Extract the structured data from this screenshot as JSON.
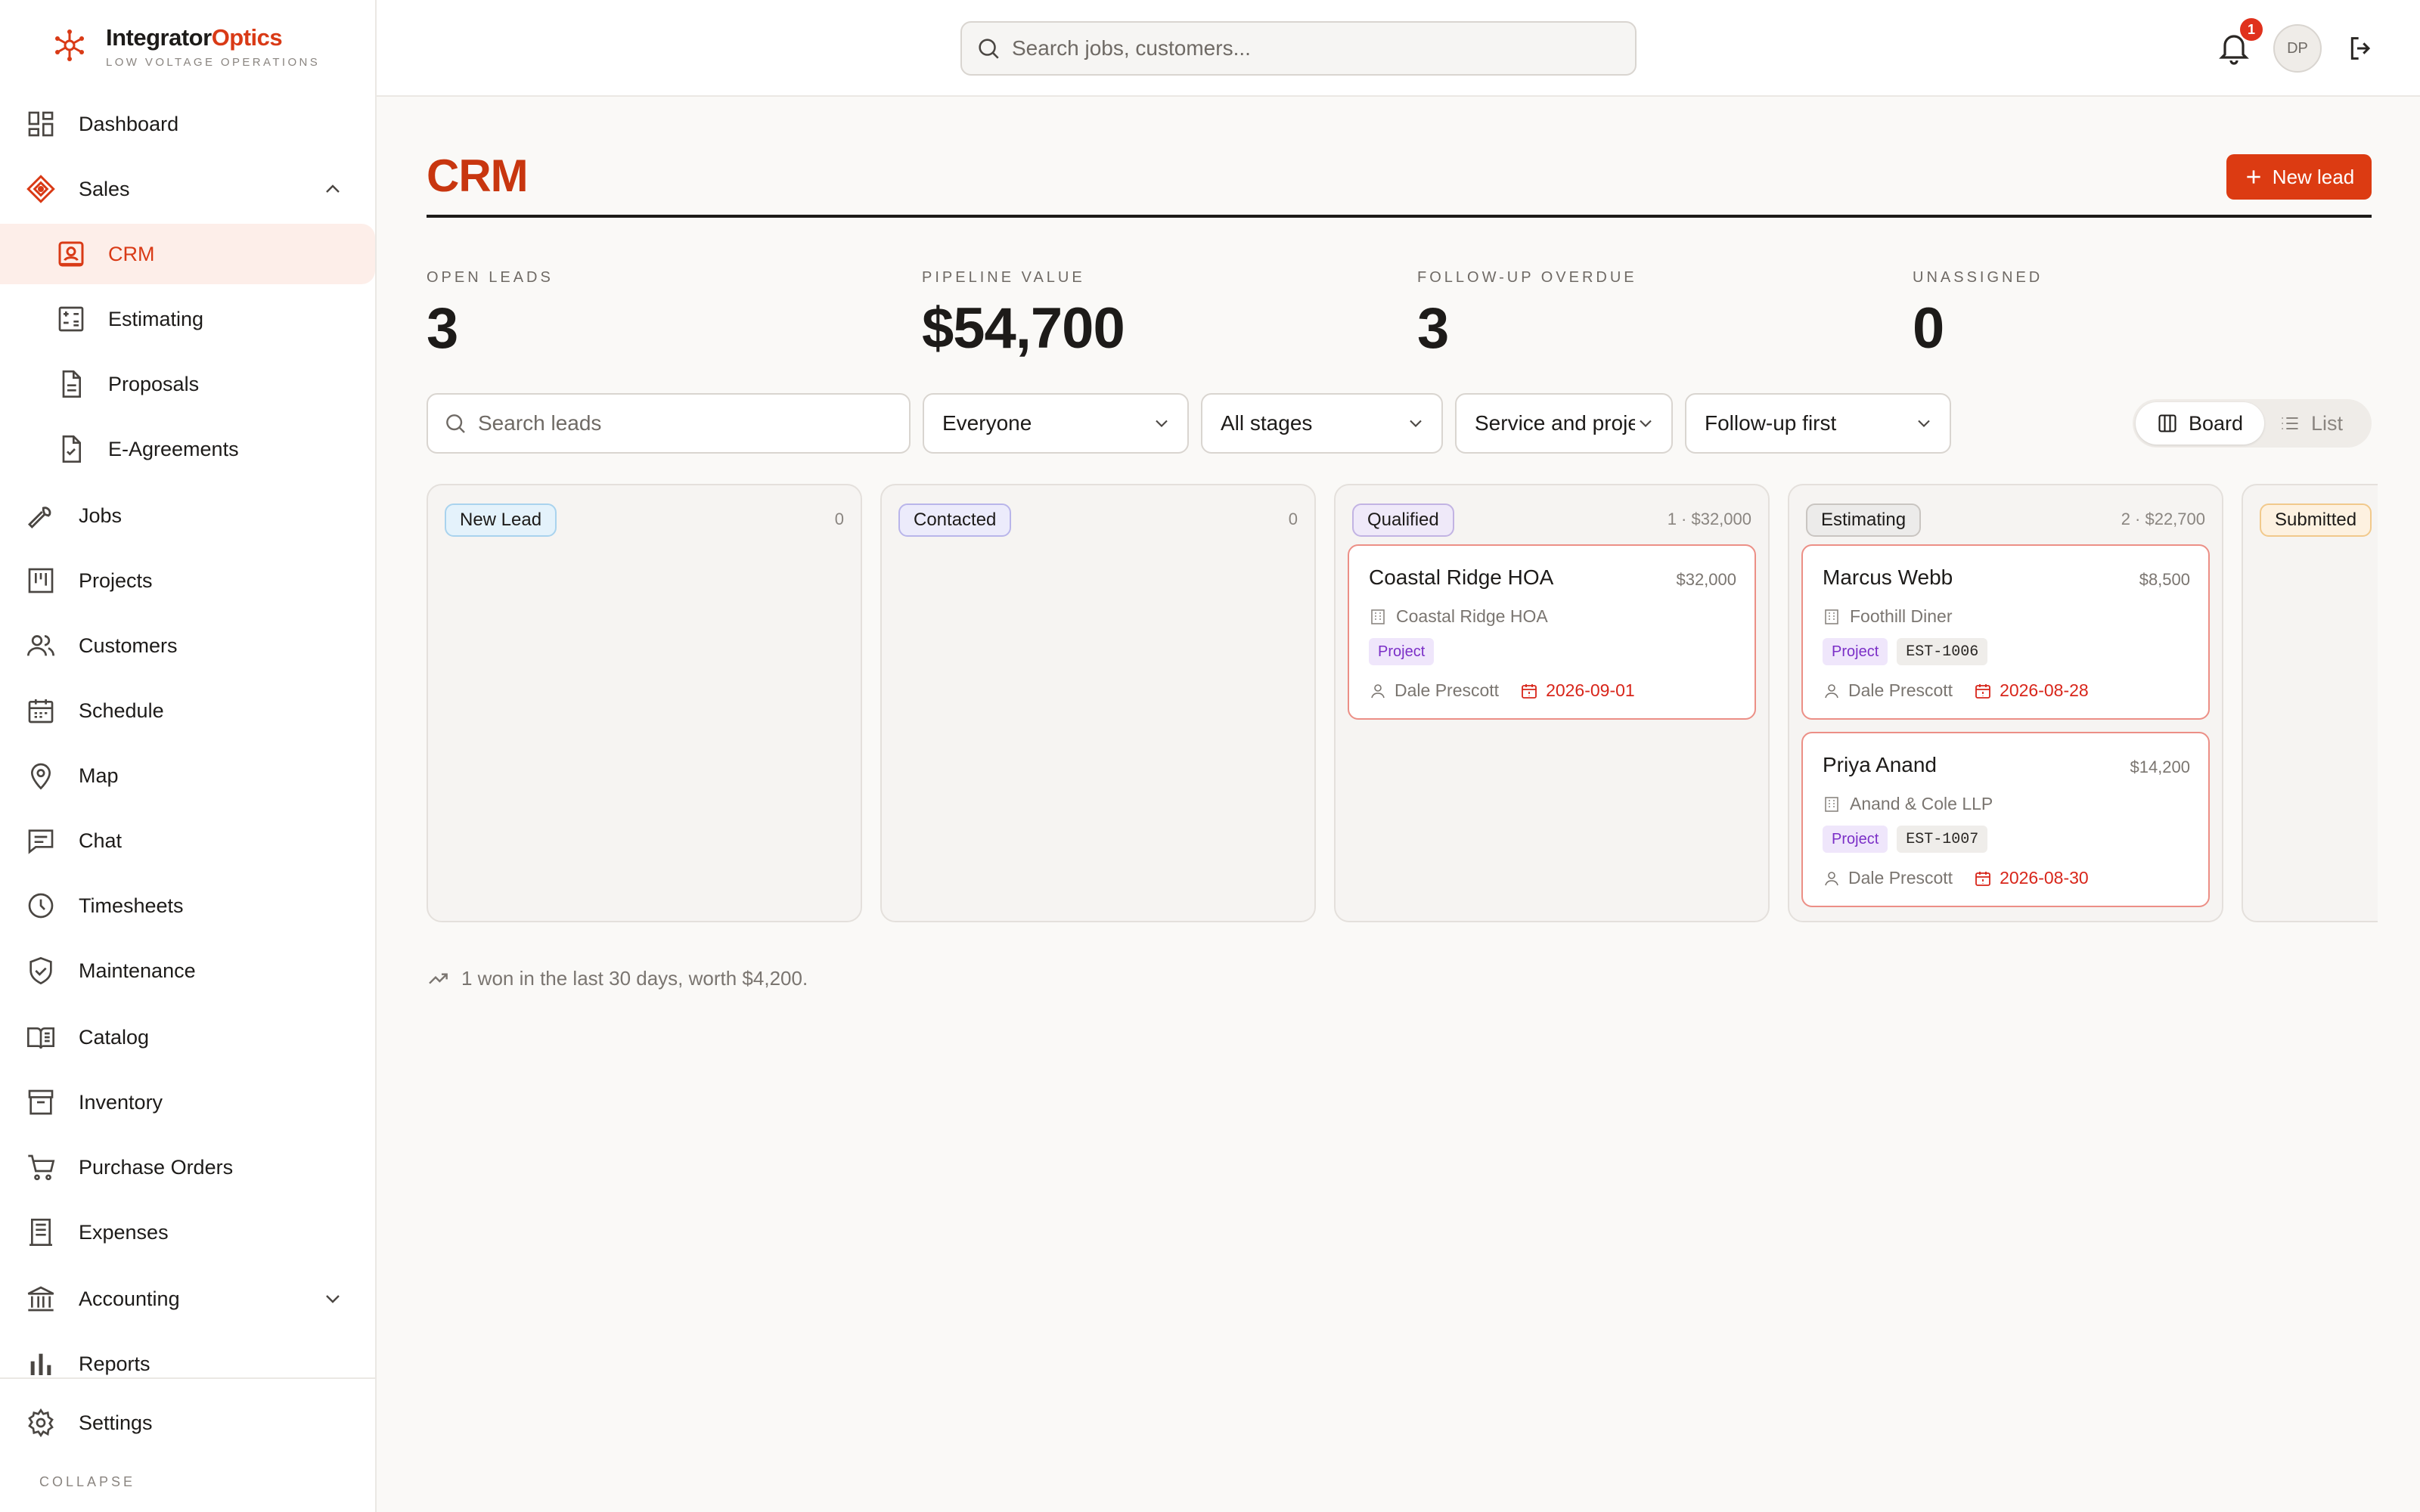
{
  "brand": {
    "name_part1": "Integrator",
    "name_part2": "Optics",
    "tagline": "LOW VOLTAGE OPERATIONS"
  },
  "sidebar": {
    "items": [
      {
        "label": "Dashboard",
        "icon": "dashboard-icon"
      },
      {
        "label": "Sales",
        "icon": "tag-icon",
        "expanded": true
      },
      {
        "label": "CRM",
        "icon": "contact-card-icon",
        "active": true
      },
      {
        "label": "Estimating",
        "icon": "calculator-icon"
      },
      {
        "label": "Proposals",
        "icon": "document-icon"
      },
      {
        "label": "E-Agreements",
        "icon": "document-check-icon"
      },
      {
        "label": "Jobs",
        "icon": "wrench-icon"
      },
      {
        "label": "Projects",
        "icon": "kanban-icon"
      },
      {
        "label": "Customers",
        "icon": "users-icon"
      },
      {
        "label": "Schedule",
        "icon": "calendar-icon"
      },
      {
        "label": "Map",
        "icon": "map-pin-icon"
      },
      {
        "label": "Chat",
        "icon": "chat-icon"
      },
      {
        "label": "Timesheets",
        "icon": "clock-icon"
      },
      {
        "label": "Maintenance",
        "icon": "shield-check-icon"
      },
      {
        "label": "Catalog",
        "icon": "book-icon"
      },
      {
        "label": "Inventory",
        "icon": "archive-icon"
      },
      {
        "label": "Purchase Orders",
        "icon": "cart-icon"
      },
      {
        "label": "Expenses",
        "icon": "receipt-icon"
      },
      {
        "label": "Accounting",
        "icon": "bank-icon",
        "expanded": false
      },
      {
        "label": "Reports",
        "icon": "bar-chart-icon"
      }
    ],
    "settings_label": "Settings",
    "collapse_label": "COLLAPSE"
  },
  "topbar": {
    "search_placeholder": "Search jobs, customers...",
    "notification_count": "1",
    "user_initials": "DP"
  },
  "page": {
    "title": "CRM",
    "new_lead_label": "New lead"
  },
  "stats": [
    {
      "label": "OPEN LEADS",
      "value": "3"
    },
    {
      "label": "PIPELINE VALUE",
      "value": "$54,700"
    },
    {
      "label": "FOLLOW-UP OVERDUE",
      "value": "3"
    },
    {
      "label": "UNASSIGNED",
      "value": "0"
    }
  ],
  "filters": {
    "search_placeholder": "Search leads",
    "owner": "Everyone",
    "stage": "All stages",
    "type": "Service and projects",
    "sort": "Follow-up first"
  },
  "view_toggle": {
    "board_label": "Board",
    "list_label": "List",
    "selected": "Board"
  },
  "board": {
    "columns": [
      {
        "stage": "New Lead",
        "summary": "0",
        "cards": []
      },
      {
        "stage": "Contacted",
        "summary": "0",
        "cards": []
      },
      {
        "stage": "Qualified",
        "summary": "1 · $32,000",
        "cards": [
          {
            "name": "Coastal Ridge HOA",
            "amount": "$32,000",
            "company": "Coastal Ridge HOA",
            "type": "Project",
            "estimate": "",
            "owner": "Dale Prescott",
            "due": "2026-09-01"
          }
        ]
      },
      {
        "stage": "Estimating",
        "summary": "2 · $22,700",
        "cards": [
          {
            "name": "Marcus Webb",
            "amount": "$8,500",
            "company": "Foothill Diner",
            "type": "Project",
            "estimate": "EST-1006",
            "owner": "Dale Prescott",
            "due": "2026-08-28"
          },
          {
            "name": "Priya Anand",
            "amount": "$14,200",
            "company": "Anand & Cole LLP",
            "type": "Project",
            "estimate": "EST-1007",
            "owner": "Dale Prescott",
            "due": "2026-08-30"
          }
        ]
      },
      {
        "stage": "Submitted",
        "summary": "",
        "cards": []
      }
    ]
  },
  "won_summary": "1 won in the last 30 days, worth $4,200.",
  "colors": {
    "accent": "#dc3b12",
    "overdue": "#d8251a",
    "project_tag": "#7b2fc7"
  }
}
